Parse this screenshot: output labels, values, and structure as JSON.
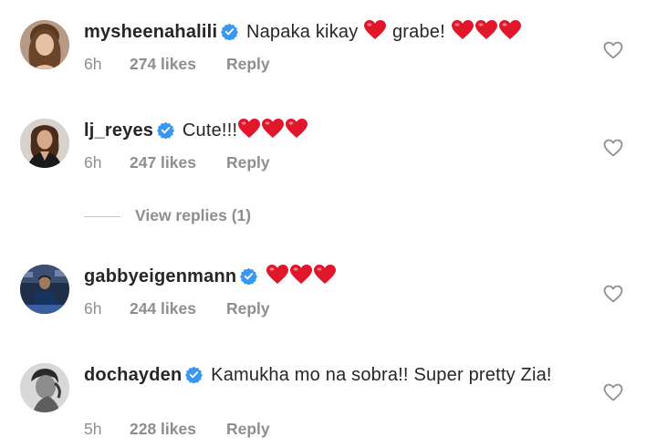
{
  "comments": [
    {
      "username": "mysheenahalili",
      "verified": true,
      "text_before": "Napaka kikay",
      "text_mid": "grabe!",
      "time": "6h",
      "likes": "274 likes",
      "reply_label": "Reply"
    },
    {
      "username": "lj_reyes",
      "verified": true,
      "text_before": "Cute!!!",
      "time": "6h",
      "likes": "247 likes",
      "reply_label": "Reply"
    },
    {
      "username": "gabbyeigenmann",
      "verified": true,
      "time": "6h",
      "likes": "244 likes",
      "reply_label": "Reply"
    },
    {
      "username": "dochayden",
      "verified": true,
      "text_before": "Kamukha mo na sobra!! Super pretty Zia!",
      "time": "5h",
      "likes": "228 likes",
      "reply_label": "Reply"
    }
  ],
  "view_replies_label": "View replies (1)",
  "icons": {
    "verified": "verified-badge-icon",
    "like": "heart-outline-icon",
    "emoji": "red-heart-emoji"
  },
  "colors": {
    "verified_blue": "#3897f0",
    "heart_red": "#e0162b",
    "meta_gray": "#8e8e8e",
    "text": "#262626"
  }
}
